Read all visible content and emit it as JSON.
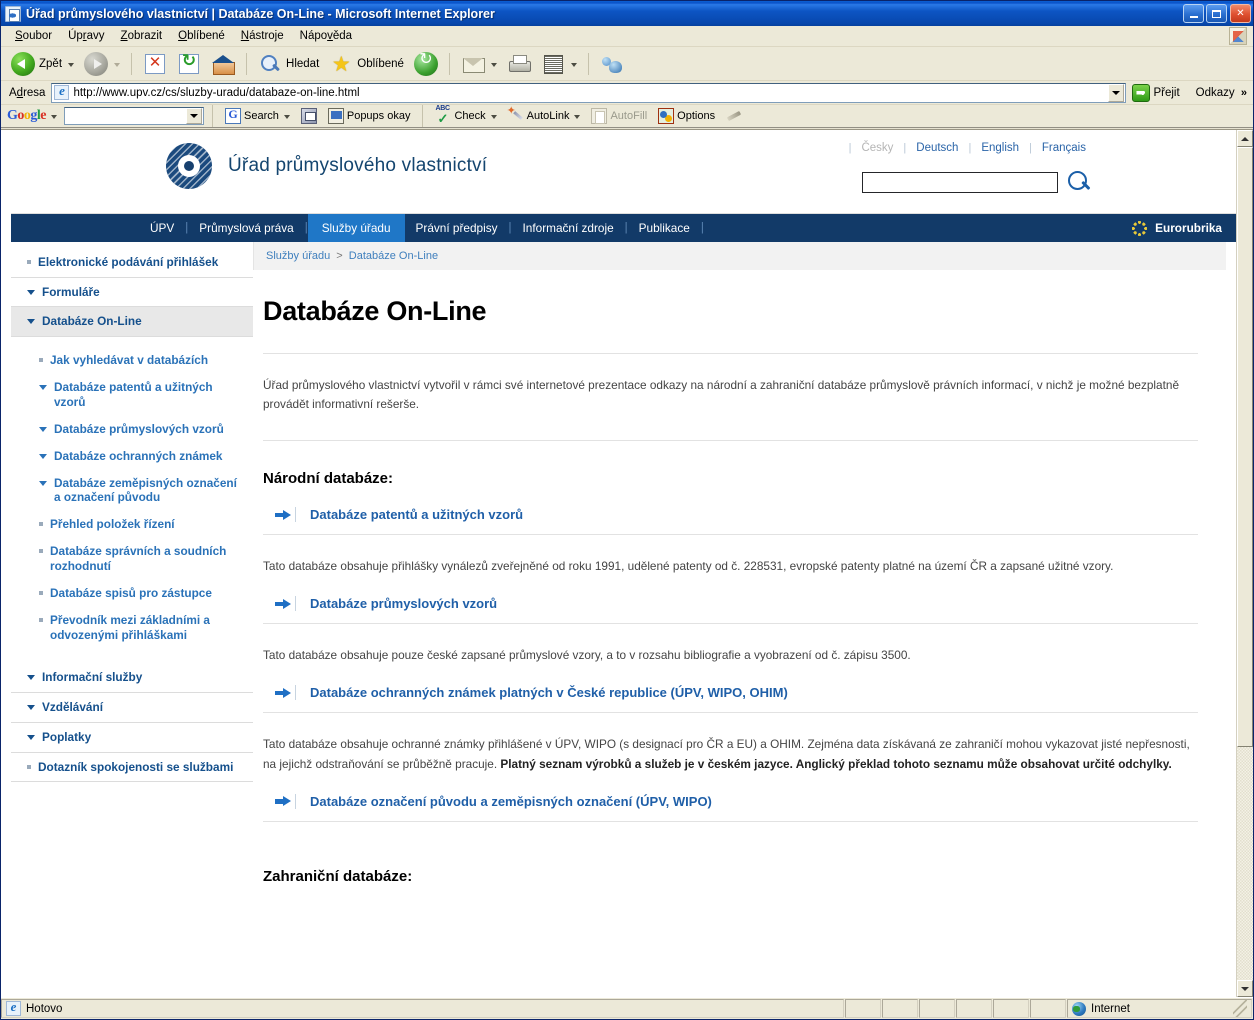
{
  "window": {
    "title": "Úřad průmyslového vlastnictví | Databáze On-Line - Microsoft Internet Explorer",
    "minimize_label": "_",
    "maximize_label": "□",
    "close_label": "✕"
  },
  "menubar": {
    "items": [
      {
        "label": "Soubor"
      },
      {
        "label": "Úpravy"
      },
      {
        "label": "Zobrazit"
      },
      {
        "label": "Oblíbené"
      },
      {
        "label": "Nástroje"
      },
      {
        "label": "Nápověda"
      }
    ]
  },
  "toolbar": {
    "back_label": "Zpět",
    "search_label": "Hledat",
    "favorites_label": "Oblíbené",
    "icons": {
      "back": "back-arrow-icon",
      "forward": "forward-arrow-icon",
      "stop": "stop-icon",
      "refresh": "refresh-icon",
      "home": "home-icon",
      "search": "search-icon",
      "favorites": "star-icon",
      "history": "history-icon",
      "mail": "mail-icon",
      "print": "print-icon",
      "edit": "edit-icon",
      "messenger": "messenger-icon"
    }
  },
  "address_bar": {
    "label": "Adresa",
    "url": "http://www.upv.cz/cs/sluzby-uradu/databaze-on-line.html",
    "go_label": "Přejit",
    "links_label": "Odkazy",
    "links_chevron": "»"
  },
  "google_toolbar": {
    "logo": [
      "G",
      "o",
      "o",
      "g",
      "l",
      "e"
    ],
    "query": "",
    "search_label": "Search",
    "popups_label": "Popups okay",
    "check_label": "Check",
    "autolink_label": "AutoLink",
    "autofill_label": "AutoFill",
    "options_label": "Options"
  },
  "site": {
    "org_name": "Úřad průmyslového vlastnictví",
    "languages": [
      {
        "label": "Česky",
        "current": true
      },
      {
        "label": "Deutsch",
        "current": false
      },
      {
        "label": "English",
        "current": false
      },
      {
        "label": "Français",
        "current": false
      }
    ],
    "search_value": "",
    "nav": [
      {
        "label": "ÚPV",
        "active": false
      },
      {
        "label": "Průmyslová práva",
        "active": false
      },
      {
        "label": "Služby úřadu",
        "active": true
      },
      {
        "label": "Právní předpisy",
        "active": false
      },
      {
        "label": "Informační zdroje",
        "active": false
      },
      {
        "label": "Publikace",
        "active": false
      }
    ],
    "euro_label": "Eurorubrika"
  },
  "sidebar": {
    "top_items": [
      {
        "label": "Elektronické podávání přihlášek",
        "marker": "square",
        "selected": false
      },
      {
        "label": "Formuláře",
        "marker": "triangle",
        "selected": false
      },
      {
        "label": "Databáze On-Line",
        "marker": "triangle",
        "selected": true
      }
    ],
    "sub_items": [
      {
        "label": "Jak vyhledávat v databázích",
        "marker": "square"
      },
      {
        "label": "Databáze patentů a užitných vzorů",
        "marker": "triangle"
      },
      {
        "label": "Databáze průmyslových vzorů",
        "marker": "triangle"
      },
      {
        "label": "Databáze ochranných známek",
        "marker": "triangle"
      },
      {
        "label": "Databáze zeměpisných označení a označení původu",
        "marker": "triangle"
      },
      {
        "label": "Přehled položek řízení",
        "marker": "square"
      },
      {
        "label": "Databáze správních a soudních rozhodnutí",
        "marker": "square"
      },
      {
        "label": "Databáze spisů pro zástupce",
        "marker": "square"
      },
      {
        "label": "Převodník mezi základními a odvozenými přihláškami",
        "marker": "square"
      }
    ],
    "bottom_items": [
      {
        "label": "Informační služby",
        "marker": "triangle",
        "selected": false
      },
      {
        "label": "Vzdělávání",
        "marker": "triangle",
        "selected": false
      },
      {
        "label": "Poplatky",
        "marker": "triangle",
        "selected": false
      },
      {
        "label": "Dotazník spokojenosti se službami",
        "marker": "square",
        "selected": false
      }
    ]
  },
  "breadcrumb": {
    "parent": "Služby úřadu",
    "separator": ">",
    "current": "Databáze On-Line"
  },
  "main": {
    "title": "Databáze On-Line",
    "intro": "Úřad průmyslového vlastnictví vytvořil v rámci své internetové prezentace odkazy na národní a zahraniční databáze průmyslově právních informací, v nichž je možné bezplatně provádět informativní rešerše.",
    "national_heading": "Národní databáze:",
    "link1": "Databáze patentů a užitných vzorů",
    "desc1": "Tato databáze obsahuje přihlášky vynálezů zveřejněné od roku 1991, udělené patenty od č. 228531, evropské patenty platné na území ČR a zapsané užitné vzory.",
    "link2": "Databáze průmyslových vzorů",
    "desc2": "Tato databáze obsahuje pouze české zapsané průmyslové vzory, a to v rozsahu bibliografie a vyobrazení od č. zápisu 3500.",
    "link3": "Databáze ochranných známek platných v České republice (ÚPV, WIPO, OHIM)",
    "desc3_normal1": "Tato databáze obsahuje ochranné známky přihlášené v ÚPV, WIPO (s designací pro ČR a EU) a OHIM. Zejména data získávaná ze zahraničí mohou vykazovat jisté nepřesnosti, na jejichž odstraňování se průběžně pracuje. ",
    "desc3_bold": "Platný seznam výrobků a služeb je v českém jazyce. Anglický překlad tohoto seznamu může obsahovat určité odchylky.",
    "link4": "Databáze označení původu a zeměpisných označení (ÚPV, WIPO)",
    "foreign_heading": "Zahraniční databáze:"
  },
  "statusbar": {
    "status": "Hotovo",
    "zone": "Internet"
  }
}
